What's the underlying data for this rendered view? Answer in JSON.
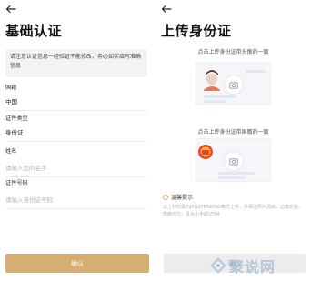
{
  "left": {
    "title": "基础认证",
    "notice": "请注意认证信息一经验证不能修改，务必如实填写准确信息",
    "fields": [
      {
        "label": "国籍",
        "value": "中国"
      },
      {
        "label": "证件类型",
        "value": "身份证"
      },
      {
        "label": "姓名",
        "placeholder": "请输入您的名字"
      },
      {
        "label": "证件号码",
        "placeholder": "请输入身份证号码"
      }
    ],
    "confirm_label": "确认",
    "accent_color": "#d6ae73"
  },
  "right": {
    "title": "上传身份证",
    "front_caption": "点击上传身份证带头像的一面",
    "back_caption": "点击上传身份证带国徽的一面",
    "tips_title": "温馨提示",
    "tips_text": "以上材料需为JPG/JPEG/PNG格式上传，并保证照片清晰，边角完整，亮度均匀，且大小不超过5M",
    "confirm_label": "确认"
  },
  "watermark": {
    "text": "聚说网",
    "color": "#9fb6cc"
  },
  "icons": {
    "back": "back-arrow-icon",
    "camera": "camera-icon",
    "avatar": "avatar-icon",
    "emblem": "national-emblem-icon",
    "tips": "info-circle-icon"
  }
}
